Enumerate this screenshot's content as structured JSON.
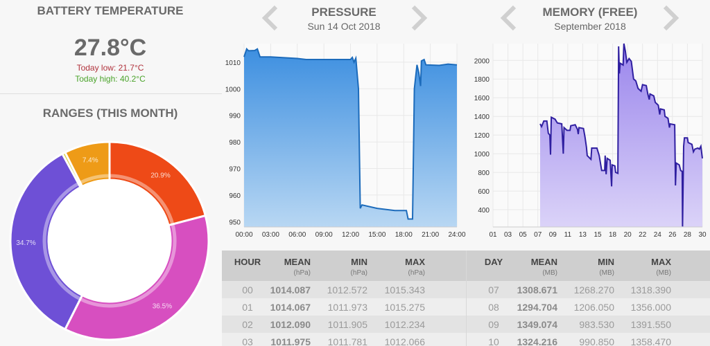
{
  "battery": {
    "title": "BATTERY TEMPERATURE",
    "value": "27.8°C",
    "low": "Today low: 21.7°C",
    "high": "Today high: 40.2°C",
    "low_color": "#b0323c",
    "high_color": "#4aa32a"
  },
  "ranges": {
    "title": "RANGES (THIS MONTH)"
  },
  "pressure": {
    "title": "PRESSURE",
    "subtitle": "Sun 14 Oct 2018",
    "prev_icon": "chevron-left-icon",
    "next_icon": "chevron-right-icon"
  },
  "memory": {
    "title": "MEMORY (FREE)",
    "subtitle": "September 2018",
    "prev_icon": "chevron-left-icon",
    "next_icon": "chevron-right-icon"
  },
  "pressure_table": {
    "headers": [
      {
        "label": "HOUR",
        "unit": ""
      },
      {
        "label": "MEAN",
        "unit": "(hPa)"
      },
      {
        "label": "MIN",
        "unit": "(hPa)"
      },
      {
        "label": "MAX",
        "unit": "(hPa)"
      }
    ],
    "rows": [
      [
        "00",
        "1014.087",
        "1012.572",
        "1015.343"
      ],
      [
        "01",
        "1014.067",
        "1011.973",
        "1015.275"
      ],
      [
        "02",
        "1012.090",
        "1011.905",
        "1012.234"
      ],
      [
        "03",
        "1011.975",
        "1011.781",
        "1012.066"
      ]
    ]
  },
  "memory_table": {
    "headers": [
      {
        "label": "DAY",
        "unit": ""
      },
      {
        "label": "MEAN",
        "unit": "(MB)"
      },
      {
        "label": "MIN",
        "unit": "(MB)"
      },
      {
        "label": "MAX",
        "unit": "(MB)"
      }
    ],
    "rows": [
      [
        "07",
        "1308.671",
        "1268.270",
        "1318.390"
      ],
      [
        "08",
        "1294.704",
        "1206.050",
        "1356.000"
      ],
      [
        "09",
        "1349.074",
        "983.530",
        "1391.550"
      ],
      [
        "10",
        "1324.216",
        "990.850",
        "1358.470"
      ]
    ]
  },
  "chart_data": [
    {
      "type": "pie",
      "donut": true,
      "title": "RANGES (THIS MONTH)",
      "slices": [
        {
          "label": "20.9%",
          "value": 20.9,
          "color": "#ee4a17"
        },
        {
          "label": "36.5%",
          "value": 36.5,
          "color": "#d74fc0"
        },
        {
          "label": "34.7%",
          "value": 34.7,
          "color": "#6e50d6"
        },
        {
          "label": "",
          "value": 0.5,
          "color": "#d4cc34"
        },
        {
          "label": "7.4%",
          "value": 7.4,
          "color": "#ee9b17"
        }
      ]
    },
    {
      "type": "area",
      "title": "PRESSURE",
      "xlim": [
        0,
        24
      ],
      "ylim": [
        948,
        1017
      ],
      "xticks": [
        "00:00",
        "03:00",
        "06:00",
        "09:00",
        "12:00",
        "15:00",
        "18:00",
        "21:00",
        "24:00"
      ],
      "yticks": [
        950,
        960,
        970,
        980,
        990,
        1000,
        1010
      ],
      "grid": true,
      "line_color": "#1c6bbb",
      "fill_top": "#3d8fe0",
      "fill_bottom": "#b8d7f3",
      "points": [
        [
          0,
          1012
        ],
        [
          0.3,
          1015
        ],
        [
          0.5,
          1014.3
        ],
        [
          1.2,
          1014.4
        ],
        [
          1.5,
          1015
        ],
        [
          1.8,
          1012
        ],
        [
          3,
          1012
        ],
        [
          6,
          1011.4
        ],
        [
          7,
          1011
        ],
        [
          9,
          1011
        ],
        [
          12,
          1011
        ],
        [
          12.2,
          1011.8
        ],
        [
          12.4,
          1010
        ],
        [
          12.6,
          1011.5
        ],
        [
          12.9,
          1000
        ],
        [
          13.1,
          955
        ],
        [
          13.3,
          956.3
        ],
        [
          15,
          955
        ],
        [
          17,
          954.2
        ],
        [
          18.3,
          954.2
        ],
        [
          18.5,
          951
        ],
        [
          19,
          951
        ],
        [
          19.2,
          1000
        ],
        [
          19.5,
          1009
        ],
        [
          19.7,
          1006
        ],
        [
          19.9,
          1001
        ],
        [
          20,
          1010.5
        ],
        [
          20.3,
          1011
        ],
        [
          20.5,
          1009
        ],
        [
          22,
          1008.8
        ],
        [
          23,
          1009.3
        ],
        [
          24,
          1009
        ]
      ]
    },
    {
      "type": "area",
      "title": "MEMORY (FREE)",
      "ylim": [
        215,
        2180
      ],
      "xticks": [
        "01",
        "03",
        "05",
        "07",
        "09",
        "11",
        "13",
        "15",
        "18",
        "20",
        "22",
        "24",
        "26",
        "28",
        "30"
      ],
      "yticks": [
        400,
        600,
        800,
        1000,
        1200,
        1400,
        1600,
        1800,
        2000
      ],
      "grid": true,
      "line_color": "#2f1fa0",
      "fill_top": "#9a85ec",
      "fill_bottom": "#dbd3f8",
      "points": [
        [
          7.3,
          1320
        ],
        [
          7.5,
          1290
        ],
        [
          7.8,
          1350
        ],
        [
          8.2,
          1350
        ],
        [
          8.4,
          1220
        ],
        [
          8.6,
          1200
        ],
        [
          8.7,
          990
        ],
        [
          8.8,
          1390
        ],
        [
          9.3,
          1370
        ],
        [
          9.6,
          1330
        ],
        [
          10.2,
          1320
        ],
        [
          10.4,
          1000
        ],
        [
          10.5,
          1280
        ],
        [
          10.9,
          1250
        ],
        [
          11.3,
          1250
        ],
        [
          11.4,
          1300
        ],
        [
          12,
          1310
        ],
        [
          12.3,
          1260
        ],
        [
          12.4,
          1210
        ],
        [
          12.5,
          1280
        ],
        [
          13.1,
          1270
        ],
        [
          13.3,
          1180
        ],
        [
          13.5,
          1070
        ],
        [
          13.6,
          980
        ],
        [
          14.1,
          940
        ],
        [
          14.2,
          1060
        ],
        [
          14.9,
          1060
        ],
        [
          15.3,
          980
        ],
        [
          15.8,
          820
        ],
        [
          16.4,
          820
        ],
        [
          16.5,
          980
        ],
        [
          16.7,
          780
        ],
        [
          16.9,
          950
        ],
        [
          17.5,
          930
        ],
        [
          17.8,
          650
        ],
        [
          17.9,
          880
        ],
        [
          18.3,
          870
        ],
        [
          18.4,
          800
        ],
        [
          18.7,
          790
        ],
        [
          18.8,
          2150
        ],
        [
          18.9,
          1860
        ],
        [
          19,
          1970
        ],
        [
          19.4,
          1950
        ],
        [
          19.5,
          2180
        ],
        [
          19.7,
          2100
        ],
        [
          19.9,
          1980
        ],
        [
          20.2,
          2020
        ],
        [
          20.5,
          1990
        ],
        [
          20.8,
          1800
        ],
        [
          21.1,
          1780
        ],
        [
          21.4,
          1700
        ],
        [
          21.8,
          1670
        ],
        [
          22,
          1740
        ],
        [
          22.5,
          1730
        ],
        [
          22.7,
          1640
        ],
        [
          22.9,
          1580
        ],
        [
          23,
          1640
        ],
        [
          23.5,
          1620
        ],
        [
          23.7,
          1550
        ],
        [
          24.1,
          1520
        ],
        [
          24.3,
          1420
        ],
        [
          24.4,
          1480
        ],
        [
          24.9,
          1470
        ],
        [
          25,
          1400
        ],
        [
          25.4,
          1380
        ],
        [
          25.6,
          1280
        ],
        [
          25.7,
          1320
        ],
        [
          26.3,
          1310
        ],
        [
          26.4,
          660
        ],
        [
          26.5,
          900
        ],
        [
          26.9,
          880
        ],
        [
          27.1,
          820
        ],
        [
          27.3,
          810
        ],
        [
          27.35,
          220
        ],
        [
          27.5,
          1080
        ],
        [
          27.6,
          1170
        ],
        [
          28,
          1170
        ],
        [
          28.1,
          1120
        ],
        [
          28.6,
          1100
        ],
        [
          28.8,
          1020
        ],
        [
          29,
          1050
        ],
        [
          29.4,
          1060
        ],
        [
          29.6,
          1050
        ],
        [
          29.8,
          1080
        ],
        [
          30,
          950
        ]
      ]
    }
  ]
}
